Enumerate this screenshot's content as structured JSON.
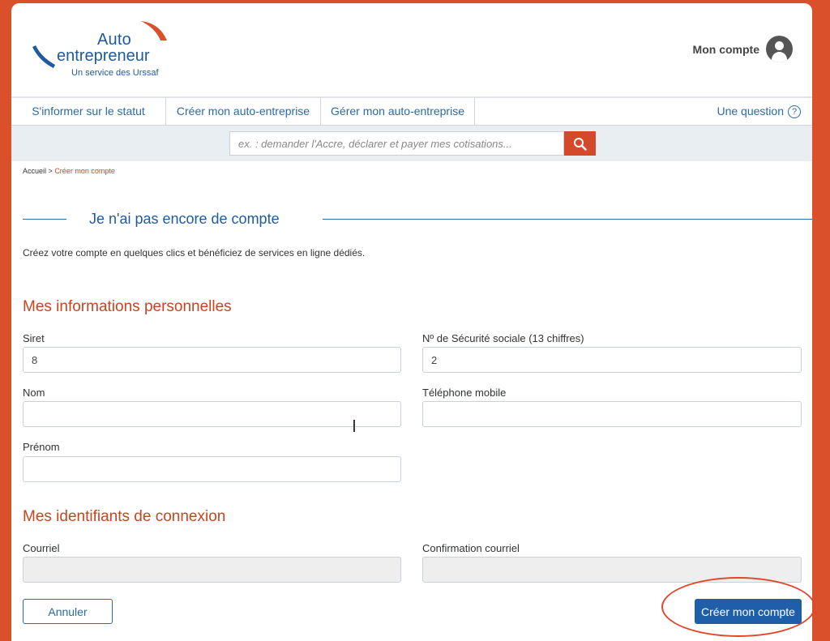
{
  "header": {
    "logo": {
      "line1": "Auto",
      "line2": "entrepreneur",
      "tagline": "Un service des Urssaf"
    },
    "account_label": "Mon compte",
    "account_icon": "user-circle-icon"
  },
  "nav": {
    "items": [
      {
        "label": "S'informer sur le statut"
      },
      {
        "label": "Créer mon auto-entreprise"
      },
      {
        "label": "Gérer mon auto-entreprise"
      }
    ],
    "question_label": "Une question",
    "question_icon": "?"
  },
  "search": {
    "placeholder": "ex. : demander l'Accre, déclarer et payer mes cotisations...",
    "button_icon": "search-icon"
  },
  "breadcrumb": {
    "home": "Accueil",
    "separator": ">",
    "current": "Créer mon compte"
  },
  "page": {
    "title": "Je n'ai pas encore de compte",
    "intro": "Créez votre compte en quelques clics et bénéficiez de services en ligne dédiés."
  },
  "personal": {
    "heading": "Mes informations personnelles",
    "siret_label": "Siret",
    "siret_value": "8",
    "nss_label": "Nº de Sécurité sociale (13 chiffres)",
    "nss_value": "2",
    "nom_label": "Nom",
    "nom_value": "",
    "phone_label": "Téléphone mobile",
    "phone_value": "",
    "prenom_label": "Prénom",
    "prenom_value": ""
  },
  "login": {
    "heading": "Mes identifiants de connexion",
    "email_label": "Courriel",
    "email_confirm_label": "Confirmation courriel"
  },
  "actions": {
    "cancel_label": "Annuler",
    "create_label": "Créer mon compte"
  },
  "colors": {
    "brand_orange": "#d9502a",
    "brand_blue": "#1e5b9e",
    "primary_button": "#1f5ea8",
    "heading_red": "#c8451f"
  }
}
